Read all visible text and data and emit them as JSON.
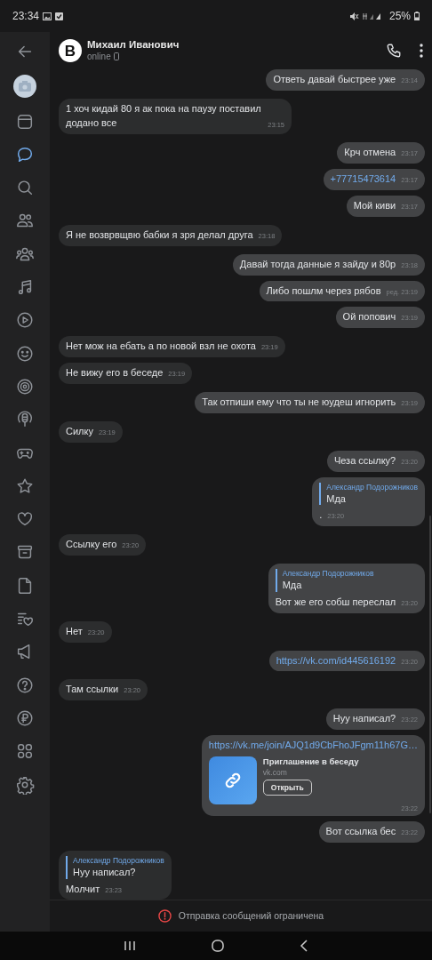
{
  "status_bar": {
    "time": "23:34",
    "battery": "25%"
  },
  "sidebar": {
    "items": [
      {
        "kind": "back",
        "selected": false
      },
      {
        "kind": "avatar",
        "selected": false
      },
      {
        "kind": "window",
        "selected": false
      },
      {
        "kind": "chat",
        "selected": true
      },
      {
        "kind": "search",
        "selected": false
      },
      {
        "kind": "friends",
        "selected": false
      },
      {
        "kind": "community",
        "selected": false
      },
      {
        "kind": "music",
        "selected": false
      },
      {
        "kind": "play",
        "selected": false
      },
      {
        "kind": "smile",
        "selected": false
      },
      {
        "kind": "target",
        "selected": false
      },
      {
        "kind": "podcast",
        "selected": false
      },
      {
        "kind": "gamepad",
        "selected": false
      },
      {
        "kind": "star",
        "selected": false
      },
      {
        "kind": "heart",
        "selected": false
      },
      {
        "kind": "archive",
        "selected": false
      },
      {
        "kind": "file",
        "selected": false
      },
      {
        "kind": "list",
        "selected": false
      },
      {
        "kind": "megaphone",
        "selected": false
      },
      {
        "kind": "help",
        "selected": false
      },
      {
        "kind": "ruble",
        "selected": false
      },
      {
        "kind": "apps",
        "selected": false
      },
      {
        "kind": "settings",
        "selected": false
      }
    ]
  },
  "header": {
    "avatar_letter": "B",
    "name": "Михаил Иванович",
    "presence": "online"
  },
  "messages": [
    {
      "kind": "text",
      "outgoing": true,
      "text": "Ответь давай быстрее уже",
      "time": "23:14"
    },
    {
      "kind": "text",
      "outgoing": false,
      "text": "1 хоч кидай 80 я ак пока на паузу поставил додано все",
      "time": "23:15"
    },
    {
      "kind": "text",
      "outgoing": true,
      "text": "Крч отмена",
      "time": "23:17"
    },
    {
      "kind": "link",
      "outgoing": true,
      "text": "+77715473614",
      "time": "23:17"
    },
    {
      "kind": "text",
      "outgoing": true,
      "text": "Мой киви",
      "time": "23:17"
    },
    {
      "kind": "text",
      "outgoing": false,
      "text": "Я не возврвщвю бабки я зря делал друга",
      "time": "23:18"
    },
    {
      "kind": "text",
      "outgoing": true,
      "text": "Давай тогда данные я зайду и 80р",
      "time": "23:18"
    },
    {
      "kind": "text",
      "outgoing": true,
      "text": "Либо пошлм через рябов",
      "time": "ред. 23:19"
    },
    {
      "kind": "text",
      "outgoing": true,
      "text": "Ой попович",
      "time": "23:19"
    },
    {
      "kind": "text",
      "outgoing": false,
      "text": "Нет мож на ебать а по новой взл не охота",
      "time": "23:19"
    },
    {
      "kind": "text",
      "outgoing": false,
      "text": "Не вижу его в беседе",
      "time": "23:19"
    },
    {
      "kind": "text",
      "outgoing": true,
      "text": "Так отпиши ему что ты не юудеш игнорить",
      "time": "23:19"
    },
    {
      "kind": "text",
      "outgoing": false,
      "text": "Силку",
      "time": "23:19"
    },
    {
      "kind": "text",
      "outgoing": true,
      "text": "Чеза ссылку?",
      "time": "23:20"
    },
    {
      "kind": "reply",
      "outgoing": true,
      "reply": {
        "author": "Александр Подорожников",
        "text": "Мда"
      },
      "text": ".",
      "time": "23:20"
    },
    {
      "kind": "text",
      "outgoing": false,
      "text": "Ссылку его",
      "time": "23:20"
    },
    {
      "kind": "reply",
      "outgoing": true,
      "reply": {
        "author": "Александр Подорожников",
        "text": "Мда"
      },
      "text": "Вот же его собш переслал",
      "time": "23:20"
    },
    {
      "kind": "text",
      "outgoing": false,
      "text": "Нет",
      "time": "23:20"
    },
    {
      "kind": "link",
      "outgoing": true,
      "text": "https://vk.com/id445616192",
      "time": "23:20"
    },
    {
      "kind": "text",
      "outgoing": false,
      "text": "Там ссылки",
      "time": "23:20"
    },
    {
      "kind": "text",
      "outgoing": true,
      "text": "Нуу написал?",
      "time": "23:22"
    },
    {
      "kind": "invite",
      "outgoing": true,
      "text": "https://vk.me/join/AJQ1d9CbFhoJFgm11h67G…",
      "card": {
        "title": "Приглашение в беседу",
        "domain": "vk.com",
        "button": "Открыть"
      },
      "time": "23:22"
    },
    {
      "kind": "text",
      "outgoing": true,
      "text": "Вот ссылка бес",
      "time": "23:22"
    },
    {
      "kind": "reply",
      "outgoing": false,
      "reply": {
        "author": "Александр Подорожников",
        "text": "Нуу написал?"
      },
      "text": "Молчит",
      "time": "23:23"
    }
  ],
  "notice": "Отправка сообщений ограничена"
}
